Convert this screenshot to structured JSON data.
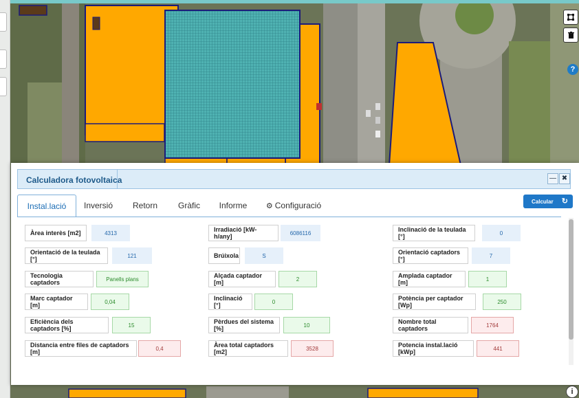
{
  "map": {
    "help_label": "?",
    "info_label": "i",
    "tools": [
      {
        "name": "select-area-icon"
      },
      {
        "name": "trash-icon"
      }
    ]
  },
  "modal": {
    "title": "Calculadora fotovoltaica",
    "minimize_label": "—",
    "close_label": "✖",
    "calc_label": "Calcular",
    "refresh_icon": "↻",
    "config_icon": "⚙",
    "tabs": [
      {
        "label": "Instal.lació",
        "active": true
      },
      {
        "label": "Inversió",
        "active": false
      },
      {
        "label": "Retorn",
        "active": false
      },
      {
        "label": "Gràfic",
        "active": false
      },
      {
        "label": "Informe",
        "active": false
      },
      {
        "label": "Configuració",
        "active": false
      }
    ],
    "fields": {
      "area_interes": {
        "label": "Àrea interès [m2]",
        "value": "4313"
      },
      "irradiacio": {
        "label": "Irradiació [kW-h/any]",
        "value": "6086116"
      },
      "inclinacio_teulada": {
        "label": "Inclinació de la teulada [°]",
        "value": "0"
      },
      "orientacio_teulada": {
        "label": "Orientació de la teulada [°]",
        "value": "121"
      },
      "bruixola": {
        "label": "Brúixola",
        "value": "S"
      },
      "orientacio_captadors": {
        "label": "Orientació captadors [°]",
        "value": "7"
      },
      "tecnologia": {
        "label": "Tecnologia captadors",
        "value": "Panells plans"
      },
      "alcada": {
        "label": "Alçada captador [m]",
        "value": "2"
      },
      "amplada": {
        "label": "Amplada captador [m]",
        "value": "1"
      },
      "marc": {
        "label": "Marc captador [m]",
        "value": "0,04"
      },
      "inclinacio": {
        "label": "Inclinació [°]",
        "value": "0"
      },
      "potencia_captador": {
        "label": "Potència per captador [Wp]",
        "value": "250"
      },
      "eficiencia": {
        "label": "Eficiència dels captadors [%]",
        "value": "15"
      },
      "perdues": {
        "label": "Pèrdues del sistema [%]",
        "value": "10"
      },
      "nombre_captadors": {
        "label": "Nombre total captadors",
        "value": "1764"
      },
      "distancia_files": {
        "label": "Distancia entre files de captadors [m]",
        "value": "0,4"
      },
      "area_captadors": {
        "label": "Àrea total captadors [m2]",
        "value": "3528"
      },
      "potencia_instal": {
        "label": "Potencia instal.lació [kWp]",
        "value": "441"
      }
    }
  }
}
